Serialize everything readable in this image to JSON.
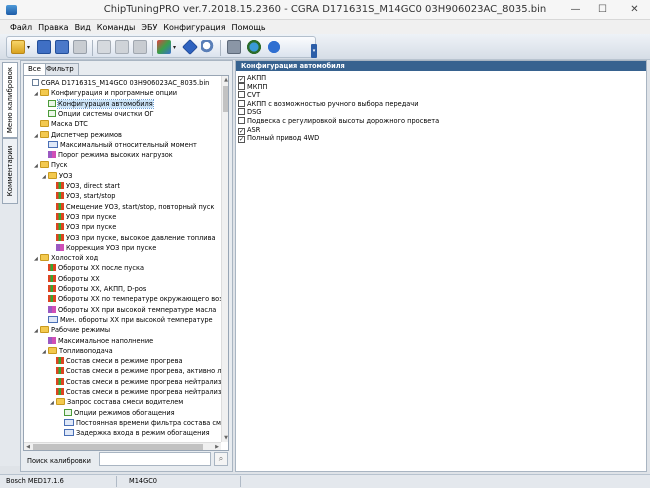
{
  "window": {
    "title": "ChipTuningPRO ver.7.2018.15.2360 - CGRA D171631S_M14GC0 03H906023AC_8035.bin",
    "min_glyph": "—",
    "max_glyph": "☐",
    "close_glyph": "✕"
  },
  "menu": [
    "Файл",
    "Правка",
    "Вид",
    "Команды",
    "ЭБУ",
    "Конфигурация",
    "Помощь"
  ],
  "toolbar": {
    "buttons": [
      "open-folder-icon",
      "save-icon",
      "save-as-icon",
      "print-icon",
      "copy-icon",
      "paste-icon",
      "undo-icon",
      "checksum-icon",
      "go-icon",
      "search-zoom-icon",
      "tools-icon",
      "network-icon",
      "help-icon"
    ],
    "caret": "▾",
    "overflow": "▾"
  },
  "vertical_tabs": {
    "calibrations": "Меню калибровок",
    "comments": "Комментарии"
  },
  "left_tabs": {
    "all": "Все",
    "filter": "Фильтр"
  },
  "tree": [
    {
      "label": "CGRA D171631S_M14GC0 03H906023AC_8035.bin",
      "icon": "doc",
      "level": 0,
      "expander": ""
    },
    {
      "label": "Конфигурация и програмные опции",
      "icon": "folder",
      "level": 1,
      "expander": "◢"
    },
    {
      "label": "Конфигурация автомобиля",
      "icon": "check",
      "level": 2,
      "expander": "",
      "selected": true
    },
    {
      "label": "Опции системы очистки ОГ",
      "icon": "check",
      "level": 2,
      "expander": ""
    },
    {
      "label": "Маска DTC",
      "icon": "folder",
      "level": 1,
      "expander": ""
    },
    {
      "label": "Диспетчер режимов",
      "icon": "folder",
      "level": 1,
      "expander": "◢"
    },
    {
      "label": "Максимальный относительный момент",
      "icon": "num",
      "level": 2,
      "expander": ""
    },
    {
      "label": "Порог режима высоких нагрузок",
      "icon": "chartp",
      "level": 2,
      "expander": ""
    },
    {
      "label": "Пуск",
      "icon": "folder",
      "level": 1,
      "expander": "◢"
    },
    {
      "label": "УОЗ",
      "icon": "folder",
      "level": 2,
      "expander": "◢"
    },
    {
      "label": "УОЗ, direct start",
      "icon": "chart",
      "level": 3,
      "expander": ""
    },
    {
      "label": "УОЗ, start/stop",
      "icon": "chart",
      "level": 3,
      "expander": ""
    },
    {
      "label": "Смещение УОЗ, start/stop, повторный пуск",
      "icon": "chart",
      "level": 3,
      "expander": ""
    },
    {
      "label": "УОЗ при пуске",
      "icon": "chart",
      "level": 3,
      "expander": ""
    },
    {
      "label": "УОЗ при пуске",
      "icon": "chart",
      "level": 3,
      "expander": ""
    },
    {
      "label": "УОЗ при пуске, высокое давление топлива",
      "icon": "chart",
      "level": 3,
      "expander": ""
    },
    {
      "label": "Коррекция УОЗ при пуске",
      "icon": "chartp",
      "level": 3,
      "expander": ""
    },
    {
      "label": "Холостой ход",
      "icon": "folder",
      "level": 1,
      "expander": "◢"
    },
    {
      "label": "Обороты ХХ после пуска",
      "icon": "chart",
      "level": 2,
      "expander": ""
    },
    {
      "label": "Обороты ХХ",
      "icon": "chart",
      "level": 2,
      "expander": ""
    },
    {
      "label": "Обороты ХХ, АКПП, D-pos",
      "icon": "chart",
      "level": 2,
      "expander": ""
    },
    {
      "label": "Обороты ХХ по температуре окружающего возд",
      "icon": "chart",
      "level": 2,
      "expander": ""
    },
    {
      "label": "Обороты ХХ при высокой температуре масла",
      "icon": "chartp",
      "level": 2,
      "expander": ""
    },
    {
      "label": "Мин. обороты ХХ при высокой температуре",
      "icon": "num",
      "level": 2,
      "expander": ""
    },
    {
      "label": "Рабочие режимы",
      "icon": "folder",
      "level": 1,
      "expander": "◢"
    },
    {
      "label": "Максимальное наполнение",
      "icon": "chartp",
      "level": 2,
      "expander": ""
    },
    {
      "label": "Топливоподача",
      "icon": "folder",
      "level": 2,
      "expander": "◢"
    },
    {
      "label": "Состав смеси в режиме прогрева",
      "icon": "chart",
      "level": 3,
      "expander": ""
    },
    {
      "label": "Состав смеси в режиме прогрева, активно лямб",
      "icon": "chart",
      "level": 3,
      "expander": ""
    },
    {
      "label": "Состав смеси в режиме прогрева нейтрализатор",
      "icon": "chart",
      "level": 3,
      "expander": ""
    },
    {
      "label": "Состав смеси в режиме прогрева нейтрализатор",
      "icon": "chart",
      "level": 3,
      "expander": ""
    },
    {
      "label": "Запрос состава смеси водителем",
      "icon": "folder",
      "level": 3,
      "expander": "◢"
    },
    {
      "label": "Опции режимов обогащения",
      "icon": "check",
      "level": 4,
      "expander": ""
    },
    {
      "label": "Постоянная времени фильтра состава смеси",
      "icon": "num",
      "level": 4,
      "expander": ""
    },
    {
      "label": "Задержка входа в режим обогащения",
      "icon": "num",
      "level": 4,
      "expander": ""
    }
  ],
  "tree_scroll": {
    "up": "▲",
    "down": "▼",
    "left": "◀",
    "right": "▶"
  },
  "search": {
    "label": "Поиск калибровки",
    "value": "",
    "button_glyph": "⌕"
  },
  "right_panel": {
    "header": "Конфигурация автомобиля",
    "options": [
      {
        "label": "АКПП",
        "checked": true
      },
      {
        "label": "МКПП",
        "checked": false
      },
      {
        "label": "CVT",
        "checked": false
      },
      {
        "label": "АКПП с возможностью ручного выбора передачи",
        "checked": false
      },
      {
        "label": "DSG",
        "checked": false
      },
      {
        "label": "Подвеска с регулировкой высоты дорожного просвета",
        "checked": false
      },
      {
        "label": "ASR",
        "checked": true
      },
      {
        "label": "Полный привод 4WD",
        "checked": true
      }
    ],
    "check_glyph": "✓"
  },
  "status": {
    "ecu": "Bosch MED17.1.6",
    "software": "M14GC0"
  }
}
